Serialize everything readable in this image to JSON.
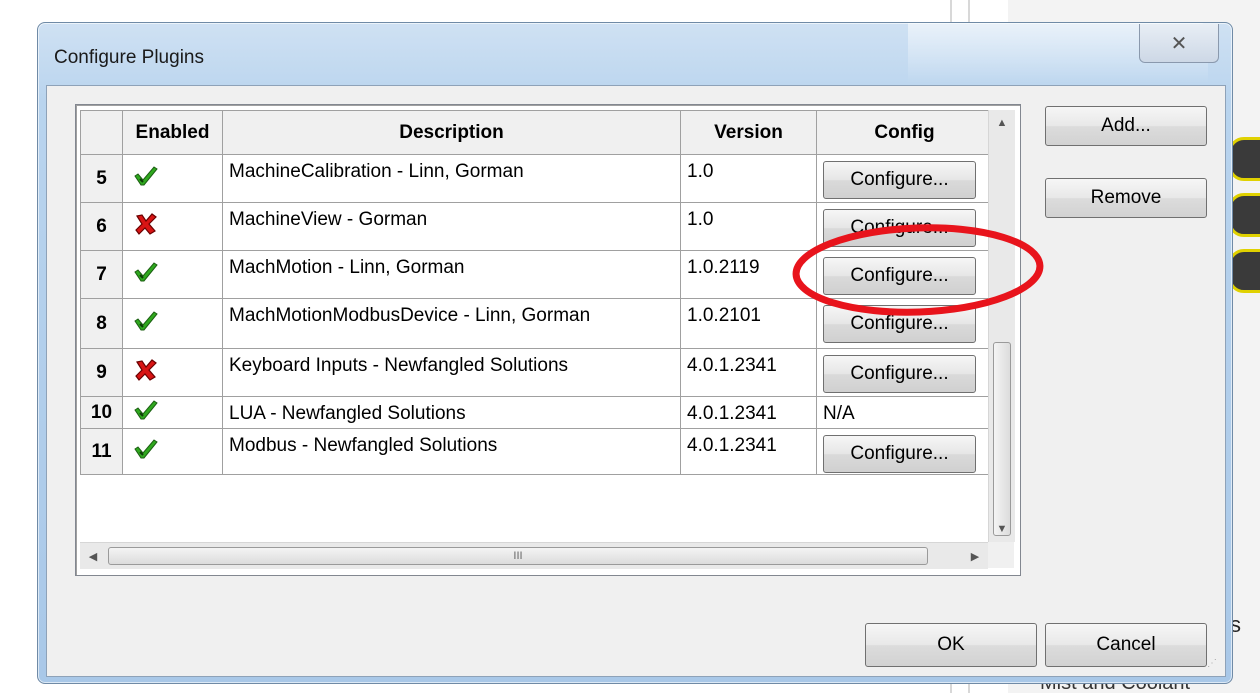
{
  "dialog": {
    "title": "Configure Plugins",
    "close_icon": "close-icon"
  },
  "grid": {
    "columns": [
      "",
      "Enabled",
      "Description",
      "Version",
      "Config"
    ],
    "rows": [
      {
        "num": "5",
        "enabled": true,
        "description": "MachineCalibration - Linn, Gorman",
        "version": "1.0",
        "config": "Configure..."
      },
      {
        "num": "6",
        "enabled": false,
        "description": "MachineView - Gorman",
        "version": "1.0",
        "config": "Configure..."
      },
      {
        "num": "7",
        "enabled": true,
        "description": "MachMotion - Linn, Gorman",
        "version": "1.0.2119",
        "config": "Configure..."
      },
      {
        "num": "8",
        "enabled": true,
        "description": "MachMotionModbusDevice - Linn, Gorman",
        "version": "1.0.2101",
        "config": "Configure..."
      },
      {
        "num": "9",
        "enabled": false,
        "description": "Keyboard Inputs - Newfangled Solutions",
        "version": "4.0.1.2341",
        "config": "Configure..."
      },
      {
        "num": "10",
        "enabled": true,
        "description": "LUA - Newfangled Solutions",
        "version": "4.0.1.2341",
        "config": "N/A"
      },
      {
        "num": "11",
        "enabled": true,
        "description": "Modbus - Newfangled Solutions",
        "version": "4.0.1.2341",
        "config": "Configure..."
      }
    ],
    "hscroll_grip": "III"
  },
  "buttons": {
    "add": "Add...",
    "remove": "Remove",
    "ok": "OK",
    "cancel": "Cancel"
  },
  "background": {
    "partial_label": "s",
    "bottom_label": "Mist and Coolant"
  },
  "colors": {
    "check_green": "#2fa81e",
    "x_red": "#d81414",
    "annotation_red": "#e8141c"
  }
}
